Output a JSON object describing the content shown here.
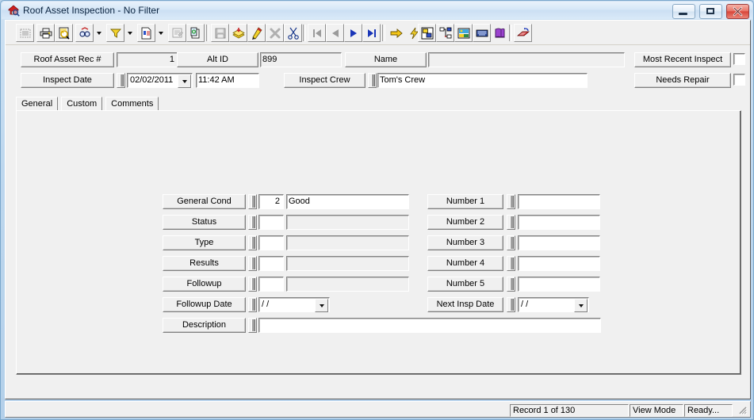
{
  "window": {
    "title": "Roof Asset Inspection - No Filter",
    "app_icon": "house-magnifier-icon",
    "minimize_label": "Minimize",
    "maximize_label": "Maximize",
    "close_label": "Close"
  },
  "toolbar": {
    "buttons": [
      {
        "name": "select-all-icon",
        "disabled": true
      },
      {
        "name": "print-icon",
        "disabled": false
      },
      {
        "name": "print-preview-icon",
        "disabled": false
      },
      {
        "name": "find-icon",
        "disabled": false
      },
      {
        "name": "find-dropdown-icon",
        "disabled": false
      },
      {
        "name": "filter-icon",
        "disabled": false
      },
      {
        "name": "filter-dropdown-icon",
        "disabled": false
      },
      {
        "name": "report-icon",
        "disabled": false
      },
      {
        "name": "report-dropdown-icon",
        "disabled": false
      },
      {
        "name": "edit-record-icon",
        "disabled": true
      },
      {
        "name": "copy-record-icon",
        "disabled": false
      },
      {
        "name": "save-icon",
        "disabled": true
      },
      {
        "name": "post-icon",
        "disabled": false
      },
      {
        "name": "edit-pencil-icon",
        "disabled": false
      },
      {
        "name": "delete-icon",
        "disabled": true
      },
      {
        "name": "cut-icon",
        "disabled": false
      },
      {
        "name": "first-record-icon",
        "disabled": true
      },
      {
        "name": "previous-record-icon",
        "disabled": true
      },
      {
        "name": "next-record-icon",
        "disabled": false
      },
      {
        "name": "last-record-icon",
        "disabled": false
      },
      {
        "name": "goto-icon",
        "disabled": false
      },
      {
        "name": "quick-action-icon",
        "disabled": false
      },
      {
        "name": "layout-icon",
        "disabled": false
      },
      {
        "name": "tree-view-icon",
        "disabled": false
      },
      {
        "name": "picture-icon",
        "disabled": false
      },
      {
        "name": "keyboard-icon",
        "disabled": false
      },
      {
        "name": "help-book-icon",
        "disabled": false
      },
      {
        "name": "exit-icon",
        "disabled": false
      }
    ]
  },
  "header": {
    "roof_asset_rec_label": "Roof Asset Rec #",
    "roof_asset_rec_value": "1",
    "alt_id_label": "Alt ID",
    "alt_id_value": "899",
    "name_label": "Name",
    "name_value": "",
    "most_recent_inspect_label": "Most Recent Inspect",
    "most_recent_inspect_checked": false,
    "inspect_date_label": "Inspect Date",
    "inspect_date_value": "02/02/2011",
    "inspect_time_value": "11:42 AM",
    "inspect_crew_label": "Inspect Crew",
    "inspect_crew_value": "Tom's Crew",
    "needs_repair_label": "Needs Repair",
    "needs_repair_checked": false
  },
  "tabs": [
    {
      "label": "General",
      "active": true
    },
    {
      "label": "Custom",
      "active": false
    },
    {
      "label": "Comments",
      "active": false
    }
  ],
  "general_tab": {
    "left_fields": [
      {
        "label": "General Cond",
        "code": "2",
        "text": "Good",
        "code_readonly": false,
        "text_readonly": false
      },
      {
        "label": "Status",
        "code": "",
        "text": "",
        "code_readonly": false,
        "text_readonly": true
      },
      {
        "label": "Type",
        "code": "",
        "text": "",
        "code_readonly": false,
        "text_readonly": true
      },
      {
        "label": "Results",
        "code": "",
        "text": "",
        "code_readonly": false,
        "text_readonly": true
      },
      {
        "label": "Followup",
        "code": "",
        "text": "",
        "code_readonly": false,
        "text_readonly": true
      }
    ],
    "followup_date": {
      "label": "Followup Date",
      "value": "/  /"
    },
    "description": {
      "label": "Description",
      "value": ""
    },
    "right_fields": [
      {
        "label": "Number 1",
        "value": ""
      },
      {
        "label": "Number 2",
        "value": ""
      },
      {
        "label": "Number 3",
        "value": ""
      },
      {
        "label": "Number 4",
        "value": ""
      },
      {
        "label": "Number 5",
        "value": ""
      }
    ],
    "next_insp_date": {
      "label": "Next Insp Date",
      "value": "/  /"
    }
  },
  "statusbar": {
    "record": "Record 1 of 130",
    "mode": "View Mode",
    "status": "Ready..."
  }
}
